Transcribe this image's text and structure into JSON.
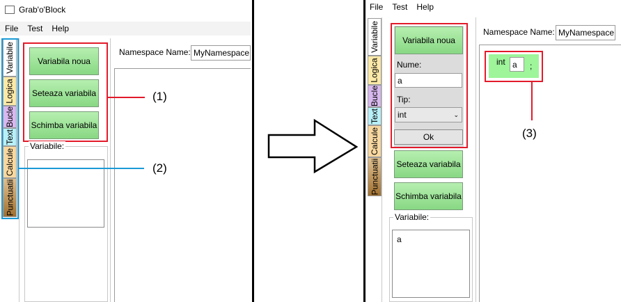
{
  "left": {
    "window_title": "Grab'o'Block",
    "menu": [
      "File",
      "Test",
      "Help"
    ],
    "tabs": [
      "Variabile",
      "Logica",
      "Bucle",
      "Text",
      "Calcule",
      "Punctuatii"
    ],
    "buttons": [
      "Variabila noua",
      "Seteaza variabila",
      "Schimba variabila"
    ],
    "variables_label": "Variabile:",
    "namespace_label": "Namespace Name:",
    "namespace_value": "MyNamespace"
  },
  "right": {
    "menu": [
      "File",
      "Test",
      "Help"
    ],
    "tabs": [
      "Variabile",
      "Logica",
      "Bucle",
      "Text",
      "Calcule",
      "Punctuatii"
    ],
    "new_var_button": "Variabila noua",
    "name_label": "Nume:",
    "name_value": "a",
    "type_label": "Tip:",
    "type_value": "int",
    "ok_button": "Ok",
    "buttons": [
      "Seteaza variabila",
      "Schimba variabila"
    ],
    "variables_label": "Variabile:",
    "variables_list": [
      "a"
    ],
    "namespace_label": "Namespace Name:",
    "namespace_value": "MyNamespace",
    "block": {
      "type": "int",
      "name": "a",
      "end": ";"
    }
  },
  "callouts": [
    "(1)",
    "(2)",
    "(3)"
  ],
  "colors": {
    "highlight_red": "#e21a2a",
    "highlight_blue": "#1a9ad6",
    "block_green": "#9ef59a"
  }
}
